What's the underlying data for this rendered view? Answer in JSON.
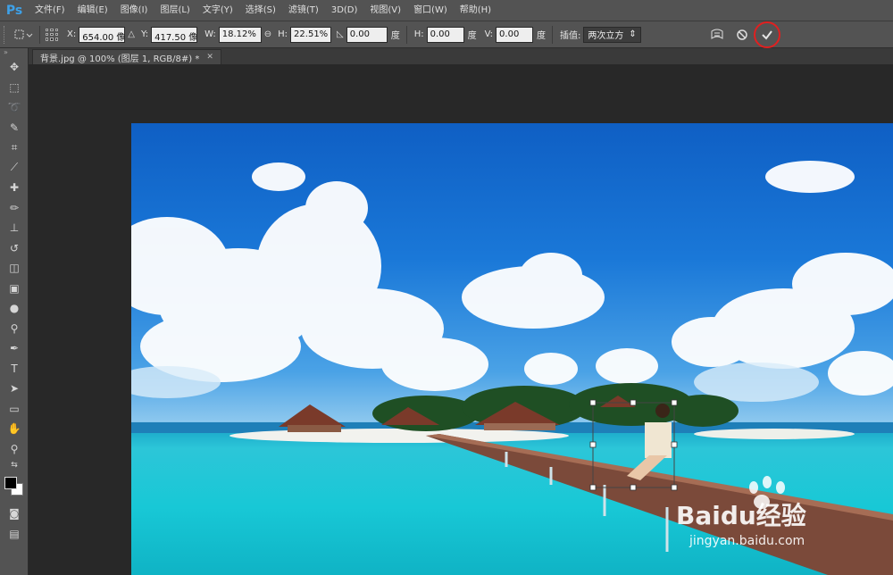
{
  "app": {
    "logo": "Ps",
    "menu": [
      "文件(F)",
      "编辑(E)",
      "图像(I)",
      "图层(L)",
      "文字(Y)",
      "选择(S)",
      "滤镜(T)",
      "3D(D)",
      "视图(V)",
      "窗口(W)",
      "帮助(H)"
    ]
  },
  "options": {
    "x_label": "X:",
    "x_value": "654.00 像",
    "y_label": "Y:",
    "y_value": "417.50 像",
    "w_label": "W:",
    "w_value": "18.12%",
    "h_label": "H:",
    "h_value": "22.51%",
    "rotate_value": "0.00",
    "degree_1": "度",
    "hskew_label": "H:",
    "hskew_value": "0.00",
    "degree_2": "度",
    "vskew_label": "V:",
    "vskew_value": "0.00",
    "degree_3": "度",
    "interp_label": "插值:",
    "interp_value": "两次立方"
  },
  "document": {
    "tab_title": "背景.jpg @ 100% (图层 1, RGB/8#) *"
  },
  "watermark": {
    "brand": "Baidu经验",
    "url": "jingyan.baidu.com"
  },
  "colors": {
    "menu_bg": "#535353",
    "canvas_bg": "#282828",
    "commit_ring": "#e02020",
    "ps_blue": "#3ea1e8"
  }
}
